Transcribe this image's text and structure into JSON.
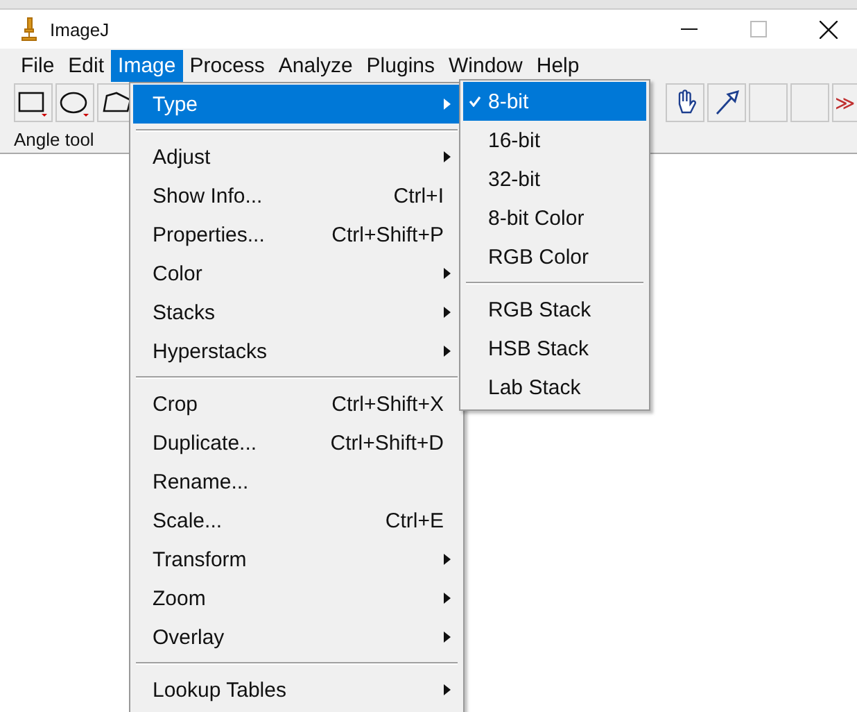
{
  "window": {
    "title": "ImageJ"
  },
  "menu_bar": [
    {
      "label": "File",
      "selected": false
    },
    {
      "label": "Edit",
      "selected": false
    },
    {
      "label": "Image",
      "selected": true
    },
    {
      "label": "Process",
      "selected": false
    },
    {
      "label": "Analyze",
      "selected": false
    },
    {
      "label": "Plugins",
      "selected": false
    },
    {
      "label": "Window",
      "selected": false
    },
    {
      "label": "Help",
      "selected": false
    }
  ],
  "toolbar_left": [
    {
      "kind": "rectangle"
    },
    {
      "kind": "oval"
    },
    {
      "kind": "polygon"
    }
  ],
  "toolbar_right": [
    {
      "kind": "hand"
    },
    {
      "kind": "pen"
    },
    {
      "kind": "blank"
    },
    {
      "kind": "blank"
    },
    {
      "kind": "more",
      "label": "≫"
    }
  ],
  "status_bar": {
    "text": "Angle tool"
  },
  "image_menu": [
    {
      "kind": "item",
      "label": "Type",
      "submenu": true,
      "selected": true
    },
    {
      "kind": "separator"
    },
    {
      "kind": "item",
      "label": "Adjust",
      "submenu": true,
      "selected": false
    },
    {
      "kind": "item",
      "label": "Show Info...",
      "shortcut": "Ctrl+I",
      "submenu": false,
      "selected": false
    },
    {
      "kind": "item",
      "label": "Properties...",
      "shortcut": "Ctrl+Shift+P",
      "submenu": false,
      "selected": false
    },
    {
      "kind": "item",
      "label": "Color",
      "submenu": true,
      "selected": false
    },
    {
      "kind": "item",
      "label": "Stacks",
      "submenu": true,
      "selected": false
    },
    {
      "kind": "item",
      "label": "Hyperstacks",
      "submenu": true,
      "selected": false
    },
    {
      "kind": "separator"
    },
    {
      "kind": "item",
      "label": "Crop",
      "shortcut": "Ctrl+Shift+X",
      "submenu": false,
      "selected": false
    },
    {
      "kind": "item",
      "label": "Duplicate...",
      "shortcut": "Ctrl+Shift+D",
      "submenu": false,
      "selected": false
    },
    {
      "kind": "item",
      "label": "Rename...",
      "submenu": false,
      "selected": false
    },
    {
      "kind": "item",
      "label": "Scale...",
      "shortcut": "Ctrl+E",
      "submenu": false,
      "selected": false
    },
    {
      "kind": "item",
      "label": "Transform",
      "submenu": true,
      "selected": false
    },
    {
      "kind": "item",
      "label": "Zoom",
      "submenu": true,
      "selected": false
    },
    {
      "kind": "item",
      "label": "Overlay",
      "submenu": true,
      "selected": false
    },
    {
      "kind": "separator"
    },
    {
      "kind": "item",
      "label": "Lookup Tables",
      "submenu": true,
      "selected": false
    }
  ],
  "type_submenu": [
    {
      "kind": "item",
      "label": "8-bit",
      "checked": true,
      "selected": true
    },
    {
      "kind": "item",
      "label": "16-bit",
      "checked": false,
      "selected": false
    },
    {
      "kind": "item",
      "label": "32-bit",
      "checked": false,
      "selected": false
    },
    {
      "kind": "item",
      "label": "8-bit Color",
      "checked": false,
      "selected": false
    },
    {
      "kind": "item",
      "label": "RGB Color",
      "checked": false,
      "selected": false
    },
    {
      "kind": "separator"
    },
    {
      "kind": "item",
      "label": "RGB Stack",
      "checked": false,
      "selected": false
    },
    {
      "kind": "item",
      "label": "HSB Stack",
      "checked": false,
      "selected": false
    },
    {
      "kind": "item",
      "label": "Lab Stack",
      "checked": false,
      "selected": false
    }
  ]
}
